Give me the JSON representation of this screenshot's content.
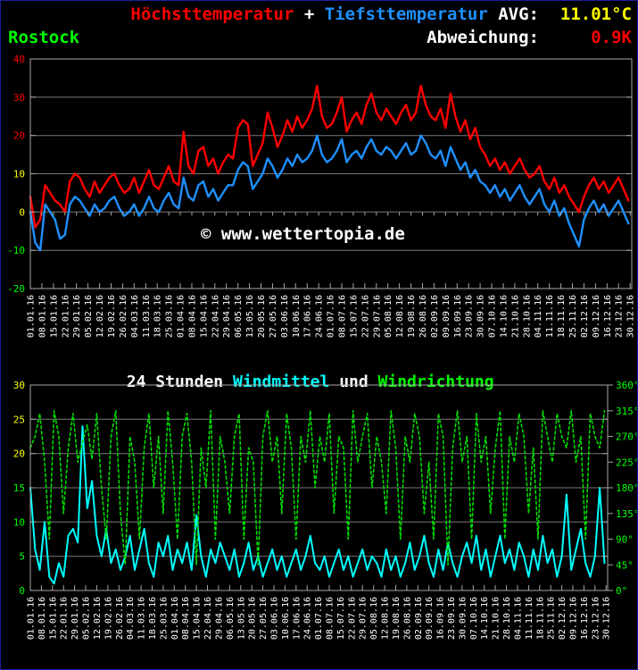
{
  "header": {
    "title_max": "Höchsttemperatur",
    "title_sep": " + ",
    "title_min": "Tiefsttemperatur",
    "avg_label": " AVG:",
    "avg_value": "11.01°C",
    "station": "Rostock",
    "deviation_label": "Abweichung:",
    "deviation_value": "0.9K"
  },
  "watermark": "© www.wettertopia.de",
  "wind_title": {
    "prefix": "24 Stunden ",
    "windmittel": "Windmittel",
    "conjunction": " und ",
    "windrichtung": "Windrichtung"
  },
  "colors": {
    "background": "#000000",
    "text": "#ffffff",
    "grid": "#787878",
    "border": "#a8a8a8",
    "tmax": "#ff0000",
    "tmin": "#1e90ff",
    "windmittel": "#00ffff",
    "windrichtung": "#00dd00",
    "avg_value": "#ffff00",
    "deviation_value": "#ff0000",
    "station": "#00ff00"
  },
  "chart_data": [
    {
      "type": "line",
      "title": "Höchsttemperatur + Tiefsttemperatur, Rostock 2016, AVG 11.01°C, Abweichung 0.9K",
      "x_total_days": 366,
      "x_tick_first_day": 1,
      "x_tick_day_step": 7,
      "x_tick_labels": [
        "01.01.16",
        "08.01.16",
        "15.01.16",
        "22.01.16",
        "29.01.16",
        "05.02.16",
        "12.02.16",
        "19.02.16",
        "26.02.16",
        "04.03.16",
        "11.03.16",
        "18.03.16",
        "25.03.16",
        "01.04.16",
        "08.04.16",
        "15.04.16",
        "22.04.16",
        "29.04.16",
        "06.05.16",
        "13.05.16",
        "20.05.16",
        "27.05.16",
        "03.06.16",
        "10.06.16",
        "17.06.16",
        "24.06.16",
        "01.07.16",
        "08.07.16",
        "15.07.16",
        "22.07.16",
        "29.07.16",
        "05.08.16",
        "12.08.16",
        "19.08.16",
        "26.08.16",
        "02.09.16",
        "09.09.16",
        "16.09.16",
        "23.09.16",
        "30.09.16",
        "07.10.16",
        "14.10.16",
        "21.10.16",
        "28.10.16",
        "04.11.16",
        "11.11.16",
        "18.11.16",
        "25.11.16",
        "02.12.16",
        "09.12.16",
        "16.12.16",
        "23.12.16",
        "30.12.16"
      ],
      "ylim": [
        -20,
        40
      ],
      "grid_values": [
        -10,
        0,
        10,
        20,
        30
      ],
      "zero_axis": 0,
      "y_ticks": [
        {
          "v": 40,
          "c": "#ff0000"
        },
        {
          "v": 30,
          "c": "#ff0000"
        },
        {
          "v": 20,
          "c": "#ff0000"
        },
        {
          "v": 10,
          "c": "#ffff00"
        },
        {
          "v": 0,
          "c": "#ffff00"
        },
        {
          "v": -10,
          "c": "#00ff00"
        },
        {
          "v": -20,
          "c": "#00ff00"
        }
      ],
      "sample_first_day": 1,
      "sample_day_step": 3,
      "series": [
        {
          "name": "Höchsttemperatur",
          "color": "#ff0000",
          "width": 2.4,
          "values": [
            4,
            -4,
            -2,
            7,
            5,
            3,
            2,
            0,
            8,
            10,
            9,
            6,
            4,
            8,
            5,
            7,
            9,
            10,
            7,
            5,
            6,
            9,
            5,
            8,
            11,
            7,
            6,
            9,
            12,
            8,
            7,
            21,
            12,
            10,
            16,
            17,
            12,
            14,
            10,
            13,
            15,
            14,
            22,
            24,
            23,
            12,
            15,
            18,
            26,
            22,
            17,
            20,
            24,
            21,
            25,
            22,
            24,
            27,
            33,
            25,
            22,
            23,
            26,
            30,
            21,
            24,
            26,
            23,
            28,
            31,
            26,
            24,
            27,
            25,
            23,
            26,
            28,
            24,
            26,
            33,
            28,
            25,
            24,
            27,
            22,
            31,
            25,
            21,
            24,
            19,
            22,
            17,
            15,
            12,
            14,
            11,
            13,
            10,
            12,
            14,
            11,
            9,
            10,
            12,
            8,
            6,
            9,
            5,
            7,
            4,
            2,
            0,
            4,
            7,
            9,
            6,
            8,
            5,
            7,
            9,
            6,
            3
          ]
        },
        {
          "name": "Tiefsttemperatur",
          "color": "#1e90ff",
          "width": 2.4,
          "values": [
            0,
            -8,
            -10,
            2,
            0,
            -2,
            -7,
            -6,
            2,
            4,
            3,
            1,
            -1,
            2,
            0,
            1,
            3,
            4,
            1,
            -1,
            0,
            2,
            -1,
            1,
            4,
            1,
            0,
            3,
            5,
            2,
            1,
            9,
            4,
            3,
            7,
            8,
            4,
            6,
            3,
            5,
            7,
            7,
            11,
            13,
            12,
            6,
            8,
            10,
            14,
            12,
            9,
            11,
            14,
            12,
            15,
            13,
            14,
            16,
            20,
            15,
            13,
            14,
            16,
            19,
            13,
            15,
            16,
            14,
            17,
            19,
            16,
            15,
            17,
            16,
            14,
            16,
            18,
            15,
            16,
            20,
            18,
            15,
            14,
            16,
            12,
            17,
            14,
            11,
            13,
            9,
            11,
            8,
            7,
            5,
            7,
            4,
            6,
            3,
            5,
            7,
            4,
            2,
            4,
            6,
            2,
            0,
            3,
            -1,
            1,
            -3,
            -6,
            -9,
            -2,
            1,
            3,
            0,
            2,
            -1,
            1,
            3,
            0,
            -3
          ]
        }
      ]
    },
    {
      "type": "line",
      "title": "24 Stunden Windmittel und Windrichtung",
      "x_total_days": 366,
      "x_tick_first_day": 1,
      "x_tick_day_step": 7,
      "x_tick_labels": [
        "01.01.16",
        "08.01.16",
        "15.01.16",
        "22.01.16",
        "29.01.16",
        "05.02.16",
        "12.02.16",
        "19.02.16",
        "26.02.16",
        "04.03.16",
        "11.03.16",
        "18.03.16",
        "25.03.16",
        "01.04.16",
        "08.04.16",
        "15.04.16",
        "22.04.16",
        "29.04.16",
        "06.05.16",
        "13.05.16",
        "20.05.16",
        "27.05.16",
        "03.06.16",
        "10.06.16",
        "17.06.16",
        "24.06.16",
        "01.07.16",
        "08.07.16",
        "15.07.16",
        "22.07.16",
        "29.07.16",
        "05.08.16",
        "12.08.16",
        "19.08.16",
        "26.08.16",
        "02.09.16",
        "09.09.16",
        "16.09.16",
        "23.09.16",
        "30.09.16",
        "07.10.16",
        "14.10.16",
        "21.10.16",
        "28.10.16",
        "04.11.16",
        "11.11.16",
        "18.11.16",
        "25.11.16",
        "02.12.16",
        "09.12.16",
        "16.12.16",
        "23.12.16",
        "30.12.16"
      ],
      "ylim": [
        0,
        30
      ],
      "ylim_right": [
        0,
        360
      ],
      "grid_values": [
        5,
        10,
        15,
        20,
        25
      ],
      "y_ticks": [
        {
          "v": 30,
          "c": "#ffff00"
        },
        {
          "v": 25,
          "c": "#ffff00"
        },
        {
          "v": 20,
          "c": "#ffff00"
        },
        {
          "v": 15,
          "c": "#00ff00"
        },
        {
          "v": 10,
          "c": "#00ff00"
        },
        {
          "v": 5,
          "c": "#00ff00"
        },
        {
          "v": 0,
          "c": "#00ff00"
        }
      ],
      "y_ticks_right": [
        {
          "v": 360,
          "label": "360°",
          "c": "#00ff00"
        },
        {
          "v": 315,
          "label": "315°",
          "c": "#00ff00"
        },
        {
          "v": 270,
          "label": "270°",
          "c": "#00ff00"
        },
        {
          "v": 225,
          "label": "225°",
          "c": "#00ff00"
        },
        {
          "v": 180,
          "label": "180°",
          "c": "#00ff00"
        },
        {
          "v": 135,
          "label": "135°",
          "c": "#00ff00"
        },
        {
          "v": 90,
          "label": "90°",
          "c": "#00ff00"
        },
        {
          "v": 45,
          "label": "45°",
          "c": "#00ff00"
        },
        {
          "v": 0,
          "label": "0°",
          "c": "#00ff00"
        }
      ],
      "sample_first_day": 1,
      "sample_day_step": 3,
      "series": [
        {
          "name": "Windmittel",
          "axis": "left",
          "color": "#00ffff",
          "width": 2,
          "values": [
            15,
            6,
            3,
            10,
            2,
            1,
            4,
            2,
            8,
            9,
            7,
            24,
            12,
            16,
            8,
            5,
            9,
            4,
            6,
            3,
            5,
            8,
            3,
            6,
            9,
            4,
            2,
            7,
            5,
            8,
            3,
            6,
            4,
            7,
            3,
            11,
            5,
            2,
            6,
            4,
            7,
            5,
            3,
            6,
            2,
            4,
            7,
            3,
            5,
            2,
            4,
            6,
            3,
            5,
            2,
            4,
            6,
            3,
            5,
            8,
            4,
            3,
            5,
            2,
            4,
            6,
            3,
            5,
            2,
            4,
            6,
            3,
            5,
            4,
            2,
            6,
            3,
            5,
            2,
            4,
            7,
            3,
            5,
            8,
            4,
            2,
            6,
            3,
            7,
            4,
            2,
            5,
            7,
            4,
            8,
            3,
            6,
            2,
            5,
            8,
            4,
            6,
            3,
            7,
            5,
            2,
            6,
            3,
            8,
            4,
            6,
            2,
            5,
            14,
            3,
            6,
            9,
            4,
            2,
            5,
            15,
            4
          ]
        },
        {
          "name": "Windrichtung",
          "axis": "right",
          "color": "#00dd00",
          "width": 1.6,
          "dash": "3 3",
          "values": [
            250,
            270,
            310,
            225,
            90,
            315,
            270,
            135,
            250,
            310,
            225,
            260,
            290,
            230,
            310,
            180,
            90,
            270,
            315,
            135,
            45,
            270,
            225,
            90,
            250,
            310,
            180,
            270,
            135,
            315,
            225,
            90,
            270,
            310,
            225,
            45,
            250,
            180,
            315,
            90,
            270,
            225,
            135,
            270,
            310,
            90,
            250,
            225,
            45,
            270,
            315,
            225,
            270,
            135,
            310,
            250,
            90,
            270,
            225,
            315,
            180,
            270,
            225,
            310,
            135,
            270,
            250,
            90,
            315,
            225,
            270,
            310,
            180,
            270,
            225,
            135,
            315,
            250,
            90,
            270,
            225,
            310,
            270,
            135,
            225,
            90,
            310,
            270,
            45,
            250,
            315,
            225,
            270,
            90,
            310,
            225,
            270,
            135,
            250,
            315,
            90,
            270,
            225,
            310,
            270,
            135,
            250,
            90,
            315,
            270,
            225,
            310,
            270,
            250,
            315,
            225,
            270,
            90,
            310,
            270,
            250,
            315
          ]
        }
      ]
    }
  ]
}
